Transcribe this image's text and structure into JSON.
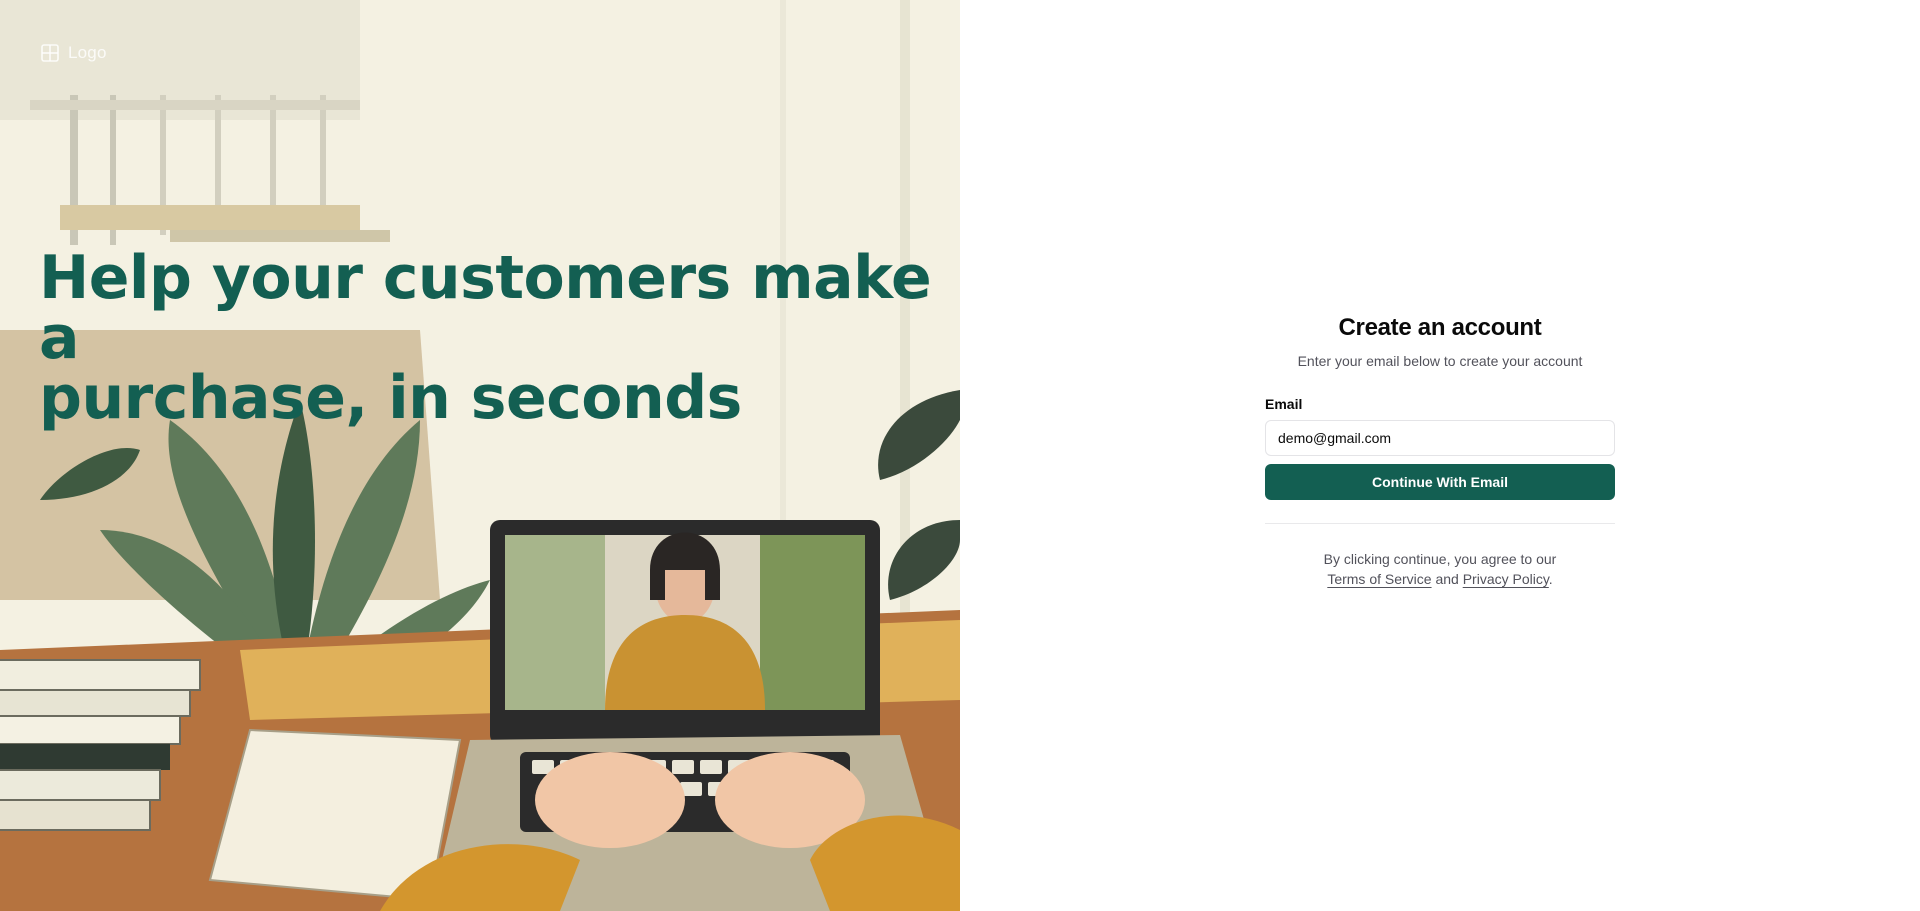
{
  "brand": {
    "logo_text": "Logo"
  },
  "hero": {
    "headline_line1": "Help your customers make a",
    "headline_line2": "purchase, in seconds"
  },
  "form": {
    "title": "Create an account",
    "subtitle": "Enter your email below to create your account",
    "email_label": "Email",
    "email_value": "demo@gmail.com",
    "submit_label": "Continue With Email",
    "legal_prefix": "By clicking continue, you agree to our",
    "terms_label": "Terms of Service",
    "legal_and": "and",
    "privacy_label": "Privacy Policy",
    "legal_suffix": "."
  },
  "colors": {
    "accent": "#135f52",
    "muted_text": "#52525b",
    "border": "#e4e4e7"
  },
  "icons": {
    "logo": "grid-logo-icon"
  }
}
